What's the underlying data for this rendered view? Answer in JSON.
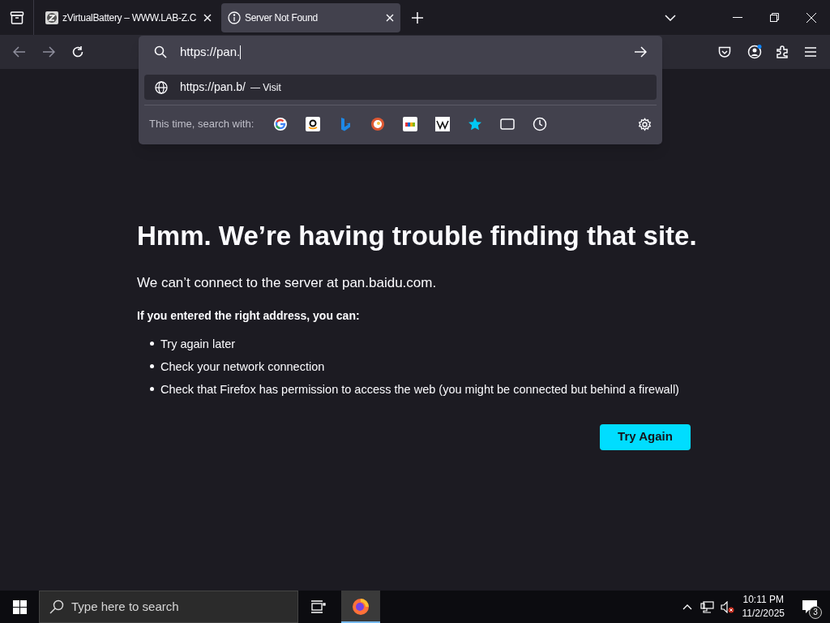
{
  "tabs": [
    {
      "kind": "site",
      "title": "zVirtualBattery – WWW.LAB-Z.C",
      "selected": false
    },
    {
      "kind": "info",
      "title": "Server Not Found",
      "selected": true
    }
  ],
  "address_bar": {
    "value": "https://pan."
  },
  "suggestions": [
    {
      "url": "https://pan.b/",
      "action": "— Visit"
    }
  ],
  "search_with": {
    "label": "This time, search with:"
  },
  "page": {
    "heading": "Hmm. We’re having trouble finding that site.",
    "message": "We can’t connect to the server at pan.baidu.com.",
    "subheading": "If you entered the right address, you can:",
    "tips": [
      "Try again later",
      "Check your network connection",
      "Check that Firefox has permission to access the web (you might be connected but behind a firewall)"
    ],
    "button": "Try Again"
  },
  "taskbar": {
    "search_placeholder": "Type here to search",
    "time": "10:11 PM",
    "date": "11/2/2025",
    "notification_count": "3"
  }
}
